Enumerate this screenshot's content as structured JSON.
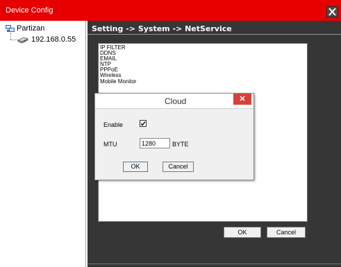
{
  "window": {
    "title": "Device Config",
    "close_icon": "close-x-icon"
  },
  "tree": {
    "root": {
      "label": "Partizan",
      "icon": "network-group-icon"
    },
    "children": [
      {
        "label": "192.168.0.55",
        "icon": "device-icon"
      }
    ]
  },
  "breadcrumb": "Setting -> System -> NetService",
  "services": [
    "IP FILTER",
    "DDNS",
    "EMAIL",
    "NTP",
    "PPPoE",
    "Wireless",
    "Mobile Monitor"
  ],
  "main_buttons": {
    "ok": "OK",
    "cancel": "Cancel"
  },
  "dialog": {
    "title": "Cloud",
    "close_label": "✕",
    "enable_label": "Enable",
    "enable_checked": true,
    "mtu_label": "MTU",
    "mtu_value": "1280",
    "unit_label": "BYTE",
    "ok_label": "OK",
    "cancel_label": "Cancel"
  },
  "colors": {
    "titlebar": "#e60000",
    "content_bg": "#363636",
    "dialog_close": "#d8403a"
  }
}
